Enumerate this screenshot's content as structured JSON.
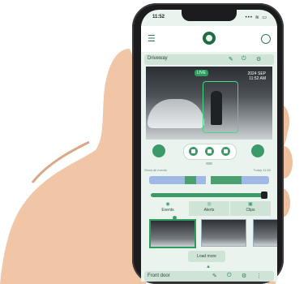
{
  "status": {
    "time": "11:52",
    "signal": "••• ≋ ▭"
  },
  "camera_top": {
    "name": "Driveway"
  },
  "video": {
    "badge": "LIVE",
    "stamp_line1": "2024 SEP",
    "stamp_line2": "11:52 AM"
  },
  "labels": {
    "left": "Show all events",
    "right": "Today 11:52"
  },
  "tabs": [
    {
      "label": "Events"
    },
    {
      "label": "Alerts"
    },
    {
      "label": "Clips"
    }
  ],
  "more_button": "Load more",
  "camera_bottom": {
    "name": "Front door"
  },
  "icons": {
    "menu": "menu-icon",
    "logo": "app-logo-icon",
    "help": "help-icon",
    "power": "power-icon",
    "edit": "edit-icon",
    "settings": "settings-icon"
  },
  "colors": {
    "accent": "#3b9b68",
    "panel": "#cfe3d7",
    "background": "#eaf3ee"
  }
}
